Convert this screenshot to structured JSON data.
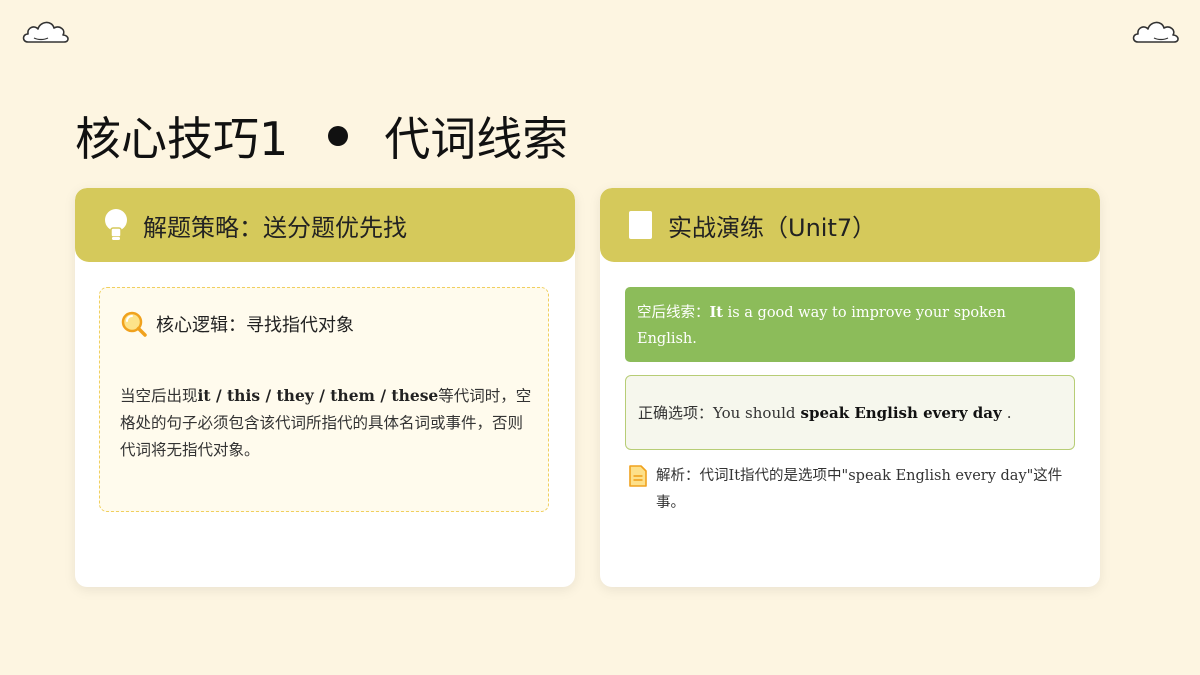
{
  "icons": {
    "cloud_left": "cloud-icon",
    "cloud_right": "cloud-icon",
    "strategy": "lightbulb-icon",
    "practice": "document-icon",
    "logic": "magnifier-icon",
    "analysis": "note-icon"
  },
  "colors": {
    "background": "#fdf5e1",
    "header": "#d5c95b",
    "clue_box": "#8cbc5a",
    "dashed_border": "#f0cf5e",
    "answer_border": "#b7cd76"
  },
  "title": {
    "main": "核心技巧1",
    "sub": "代词线索"
  },
  "left_card": {
    "header": "解题策略：送分题优先找",
    "logic_title": "核心逻辑：寻找指代对象",
    "text_prefix": "当空后出现",
    "pronouns": "it / this / they / them / these",
    "text_suffix": "等代词时，空格处的句子必须包含该代词所指代的具体名词或事件，否则代词将无指代对象。"
  },
  "right_card": {
    "header": "实战演练（Unit7）",
    "clue_label": "空后线索：",
    "clue_bold": "It",
    "clue_rest": " is a good way to improve your spoken English.",
    "answer_label": "正确选项：You should",
    "answer_bold": "speak English every day",
    "answer_end": ".",
    "analysis": "解析：代词It指代的是选项中\"speak English every day\"这件事。"
  }
}
